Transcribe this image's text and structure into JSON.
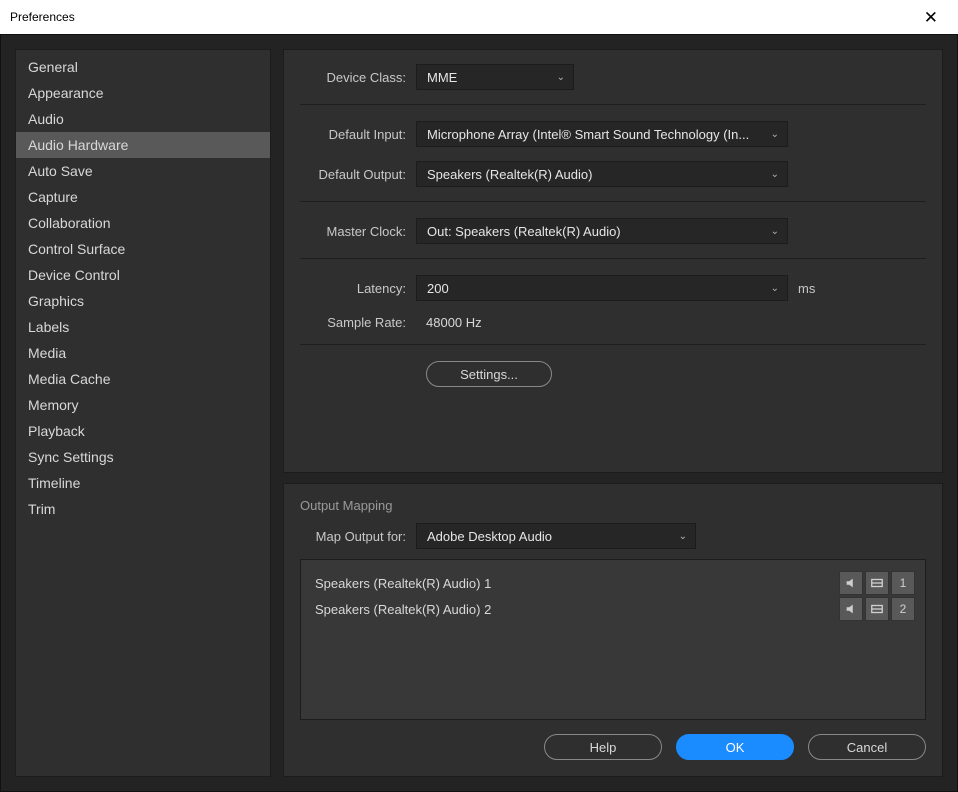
{
  "window": {
    "title": "Preferences"
  },
  "sidebar": {
    "items": [
      {
        "label": "General"
      },
      {
        "label": "Appearance"
      },
      {
        "label": "Audio"
      },
      {
        "label": "Audio Hardware",
        "selected": true
      },
      {
        "label": "Auto Save"
      },
      {
        "label": "Capture"
      },
      {
        "label": "Collaboration"
      },
      {
        "label": "Control Surface"
      },
      {
        "label": "Device Control"
      },
      {
        "label": "Graphics"
      },
      {
        "label": "Labels"
      },
      {
        "label": "Media"
      },
      {
        "label": "Media Cache"
      },
      {
        "label": "Memory"
      },
      {
        "label": "Playback"
      },
      {
        "label": "Sync Settings"
      },
      {
        "label": "Timeline"
      },
      {
        "label": "Trim"
      }
    ]
  },
  "settings": {
    "device_class_label": "Device Class:",
    "device_class_value": "MME",
    "default_input_label": "Default Input:",
    "default_input_value": "Microphone Array (Intel® Smart Sound Technology (In...",
    "default_output_label": "Default Output:",
    "default_output_value": "Speakers (Realtek(R) Audio)",
    "master_clock_label": "Master Clock:",
    "master_clock_value": "Out: Speakers (Realtek(R) Audio)",
    "latency_label": "Latency:",
    "latency_value": "200",
    "latency_unit": "ms",
    "sample_rate_label": "Sample Rate:",
    "sample_rate_value": "48000 Hz",
    "settings_button": "Settings..."
  },
  "output_mapping": {
    "group_title": "Output Mapping",
    "map_output_label": "Map Output for:",
    "map_output_value": "Adobe Desktop Audio",
    "rows": [
      {
        "name": "Speakers (Realtek(R) Audio) 1",
        "channel": "1"
      },
      {
        "name": "Speakers (Realtek(R) Audio) 2",
        "channel": "2"
      }
    ]
  },
  "footer": {
    "help": "Help",
    "ok": "OK",
    "cancel": "Cancel"
  }
}
